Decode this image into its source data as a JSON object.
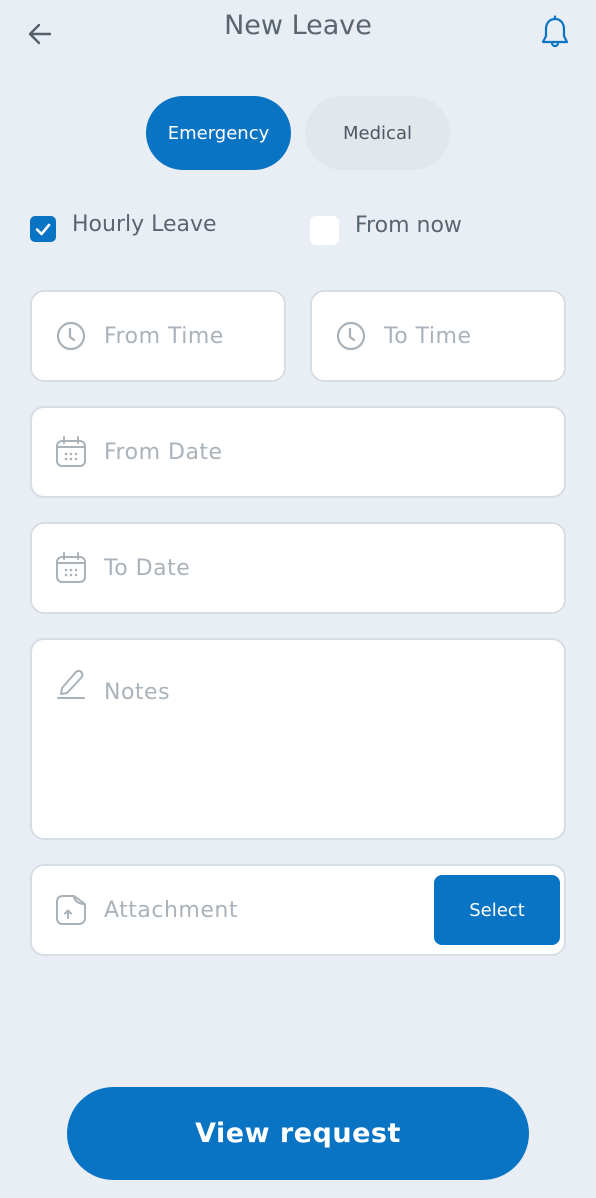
{
  "header": {
    "title": "New Leave",
    "back_icon": "arrow-left-icon",
    "notification_icon": "bell-icon"
  },
  "leave_types": [
    {
      "label": "Emergency",
      "selected": true
    },
    {
      "label": "Medical",
      "selected": false
    }
  ],
  "options": [
    {
      "label": "Hourly Leave",
      "checked": true
    },
    {
      "label": "From now",
      "checked": false
    }
  ],
  "form": {
    "from_time": {
      "placeholder": "From Time",
      "value": "",
      "icon": "clock-icon"
    },
    "to_time": {
      "placeholder": "To Time",
      "value": "",
      "icon": "clock-icon"
    },
    "from_date": {
      "placeholder": "From Date",
      "value": "",
      "icon": "calendar-icon"
    },
    "to_date": {
      "placeholder": "To Date",
      "value": "",
      "icon": "calendar-icon"
    },
    "notes": {
      "placeholder": "Notes",
      "value": "",
      "icon": "pencil-icon"
    },
    "attachment": {
      "placeholder": "Attachment",
      "value": "",
      "icon": "file-upload-icon",
      "button_label": "Select"
    }
  },
  "submit": {
    "label": "View request"
  },
  "colors": {
    "accent": "#0a74c4",
    "background": "#e9eef4",
    "placeholder": "#aab2ba",
    "text": "#5a6570"
  }
}
